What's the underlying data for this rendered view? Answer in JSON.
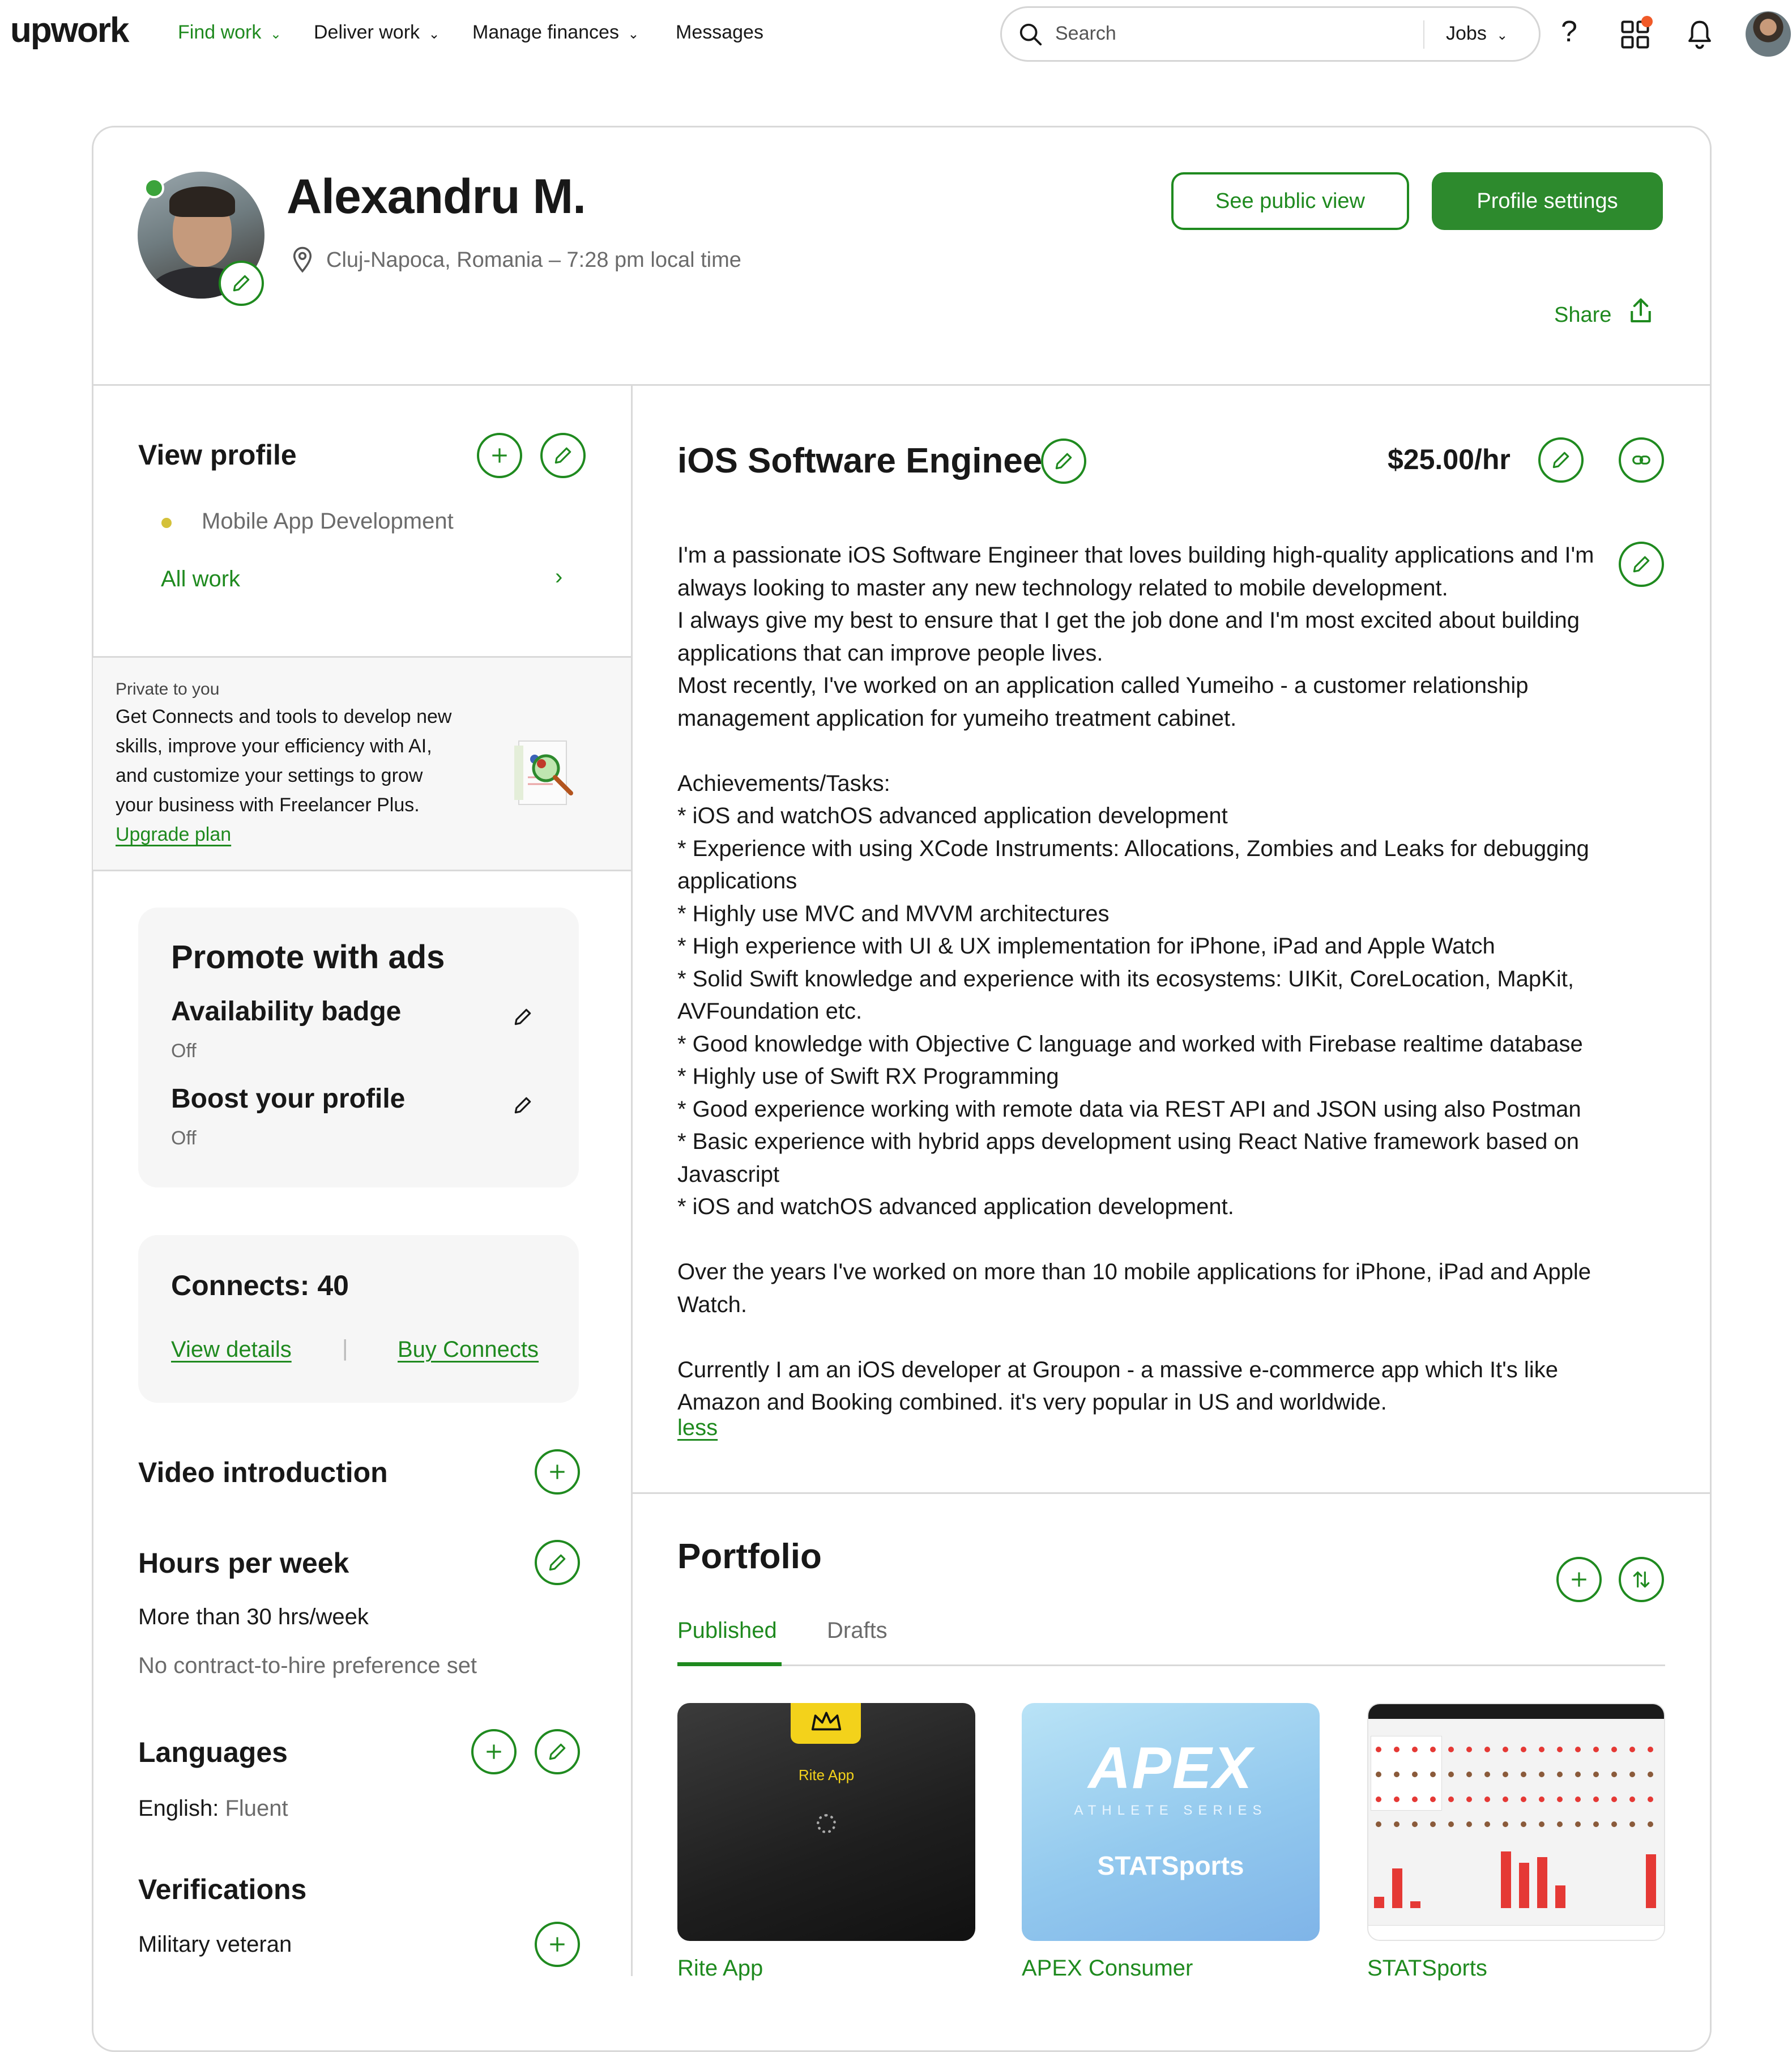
{
  "nav": {
    "logo": "upwork",
    "items": [
      {
        "label": "Find work"
      },
      {
        "label": "Deliver work"
      },
      {
        "label": "Manage finances"
      },
      {
        "label": "Messages"
      }
    ],
    "search_placeholder": "Search",
    "search_scope": "Jobs"
  },
  "profile": {
    "name": "Alexandru M.",
    "location": "Cluj-Napoca, Romania – 7:28 pm local time",
    "see_public_view": "See public view",
    "profile_settings": "Profile settings",
    "share": "Share"
  },
  "sidebar": {
    "view_profile": "View profile",
    "specialty": "Mobile App Development",
    "all_work": "All work",
    "private_label": "Private to you",
    "private_lines": [
      "Get Connects and tools to develop new",
      "skills, improve your efficiency with AI,",
      "and customize your settings to grow",
      "your business with Freelancer Plus."
    ],
    "upgrade_plan": "Upgrade plan",
    "promote_title": "Promote with ads",
    "availability_badge": "Availability badge",
    "availability_status": "Off",
    "boost_profile": "Boost your profile",
    "boost_status": "Off",
    "connects": "Connects: 40",
    "view_details": "View details",
    "separator": "|",
    "buy_connects": "Buy Connects",
    "video_intro": "Video introduction",
    "hours_title": "Hours per week",
    "hours_value": "More than 30 hrs/week",
    "hours_pref": "No contract-to-hire preference set",
    "languages_title": "Languages",
    "language_name": "English:",
    "language_level": "Fluent",
    "verifications_title": "Verifications",
    "verification_item": "Military veteran"
  },
  "main": {
    "title": "iOS Software Engineer",
    "rate": "$25.00/hr",
    "overview_lines": [
      "I'm a passionate iOS Software Engineer that loves building high-quality applications and I'm",
      "always looking to master any new technology related to mobile development.",
      "I always give my best to ensure that I get the job done and I'm most excited about building",
      "applications that can improve people lives.",
      "Most recently, I've worked on an application called Yumeiho - a customer relationship",
      "management application for yumeiho treatment cabinet.",
      "",
      "Achievements/Tasks:",
      "* iOS and watchOS advanced application development",
      "* Experience with using XCode Instruments: Allocations, Zombies and Leaks for debugging",
      "applications",
      "* Highly use MVC and MVVM architectures",
      "* High experience with UI & UX implementation for iPhone, iPad and Apple Watch",
      "* Solid Swift knowledge and experience with its ecosystems: UIKit, CoreLocation, MapKit,",
      "AVFoundation etc.",
      "* Good knowledge with Objective C language and worked with Firebase realtime database",
      "* Highly use of Swift RX Programming",
      "* Good experience working with remote data via REST API and JSON using also Postman",
      "* Basic experience with hybrid apps development using React Native framework based on",
      "Javascript",
      "* iOS and watchOS advanced application development.",
      "",
      "Over the years I've worked on more than 10 mobile applications for iPhone, iPad and Apple",
      "Watch.",
      "",
      "Currently I am an iOS developer at Groupon - a massive e-commerce app which It's like",
      "Amazon and Booking combined. it's very popular in US and worldwide."
    ],
    "less": "less",
    "portfolio_title": "Portfolio",
    "tabs": [
      {
        "label": "Published"
      },
      {
        "label": "Drafts"
      }
    ],
    "portfolio": [
      {
        "title": "Rite App",
        "thumb_text": "Rite App"
      },
      {
        "title": "APEX Consumer",
        "thumb_logo": "APEX",
        "thumb_sub": "ATHLETE SERIES",
        "thumb_brand": "STATSports"
      },
      {
        "title": "STATSports"
      }
    ]
  },
  "colors": {
    "brand_green": "#1f8a1f",
    "notification_dot": "#f05a28",
    "online_dot": "#3ba33b"
  }
}
